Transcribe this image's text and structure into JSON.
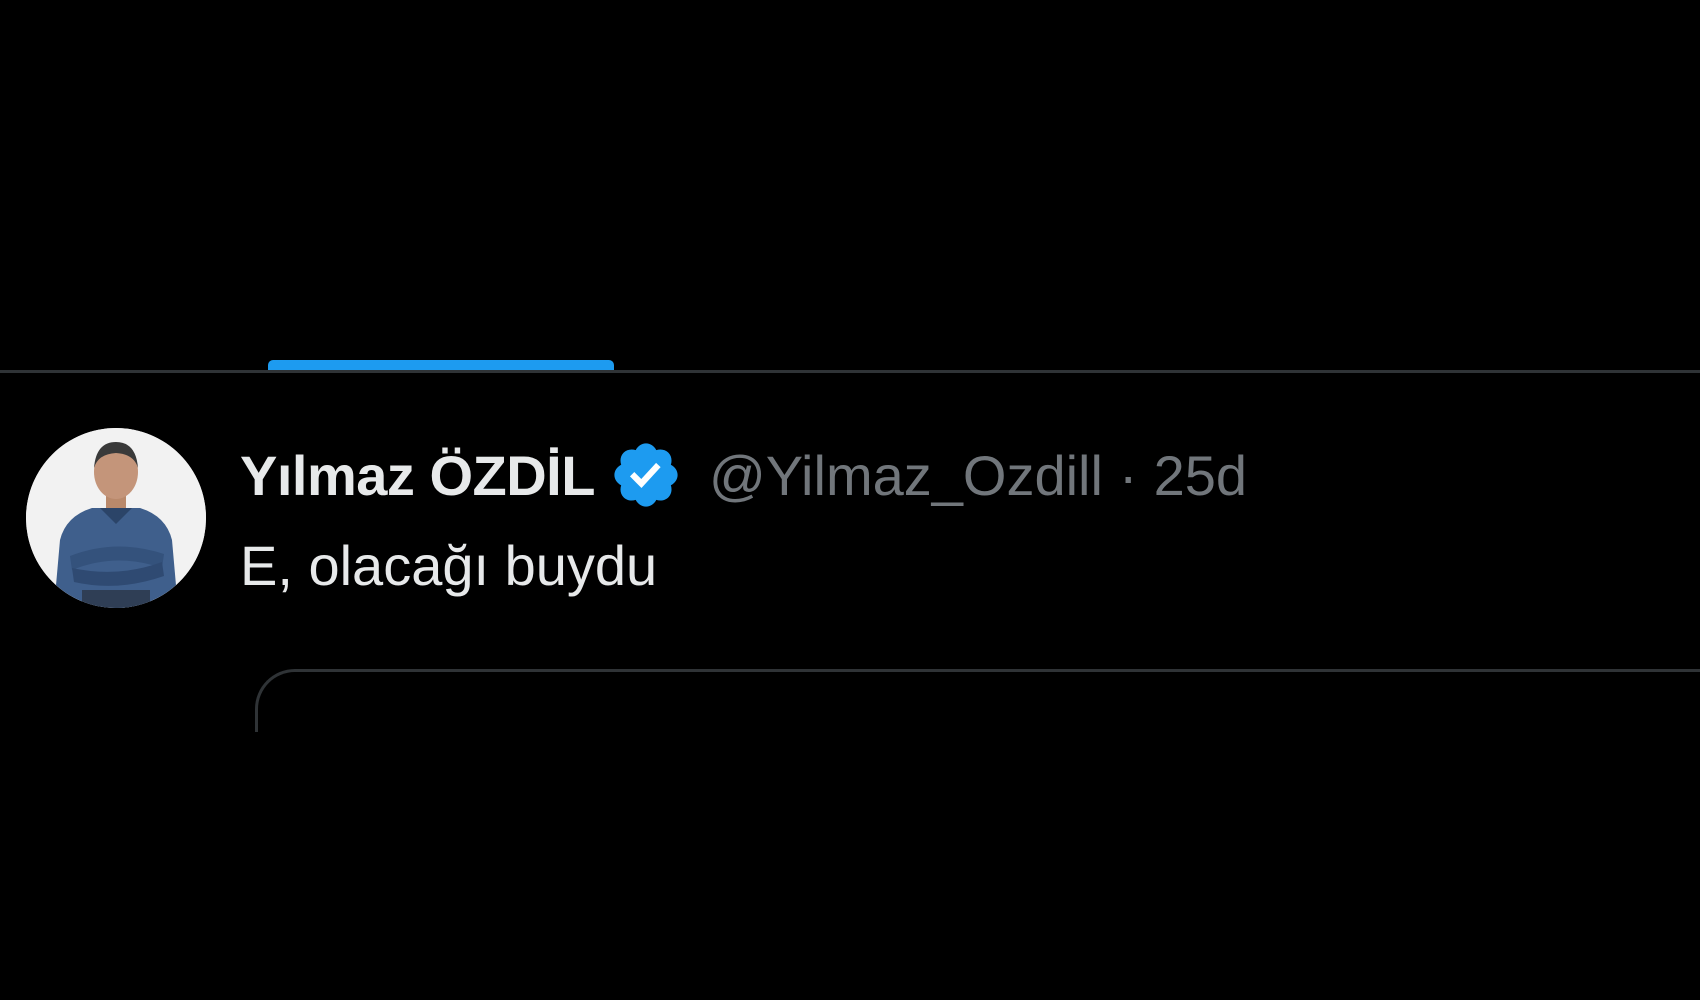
{
  "tweet": {
    "display_name": "Yılmaz ÖZDİL",
    "handle": "@Yilmaz_Ozdill",
    "separator": "·",
    "timestamp": "25d",
    "text": "E, olacağı buydu",
    "verified_icon": "verified-badge-icon"
  },
  "colors": {
    "background": "#000000",
    "accent": "#1d9bf0",
    "primary_text": "#e7e9ea",
    "secondary_text": "#71767b",
    "border": "#2f3336"
  }
}
